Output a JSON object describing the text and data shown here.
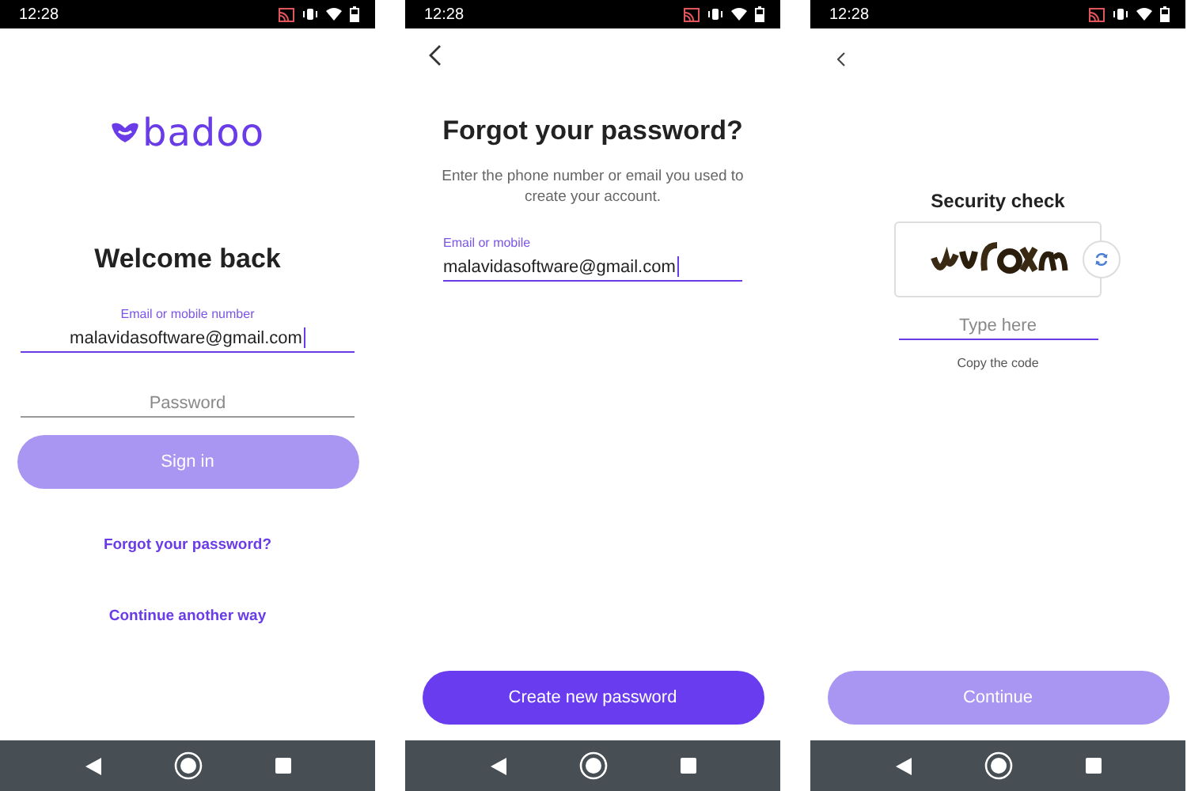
{
  "screens": [
    {
      "kind": "login",
      "status_bar": {
        "time": "12:28"
      },
      "logo": "badoo",
      "title": "Welcome back",
      "fields": [
        {
          "label": "Email or mobile number",
          "value": "malavidasoftware@gmail.com",
          "focused": true
        },
        {
          "placeholder": "Password",
          "focused": false
        }
      ],
      "button": {
        "label": "Sign in",
        "disabled": true
      },
      "links": [
        "Forgot your password?",
        "Continue another way"
      ]
    },
    {
      "kind": "forgot",
      "status_bar": {
        "time": "12:28"
      },
      "title": "Forgot your password?",
      "description": "Enter the phone number or email you used to create your account.",
      "fields": [
        {
          "label": "Email or mobile",
          "value": "malavidasoftware@gmail.com",
          "focused": true
        }
      ],
      "button": {
        "label": "Create new password",
        "disabled": false
      }
    },
    {
      "kind": "captcha",
      "status_bar": {
        "time": "12:28"
      },
      "title": "Security check",
      "captcha": {
        "kind": "picture"
      },
      "fields": [
        {
          "placeholder": "Type here",
          "focused": true
        }
      ],
      "hint": "Copy the code",
      "button": {
        "label": "Continue",
        "disabled": true
      }
    }
  ]
}
